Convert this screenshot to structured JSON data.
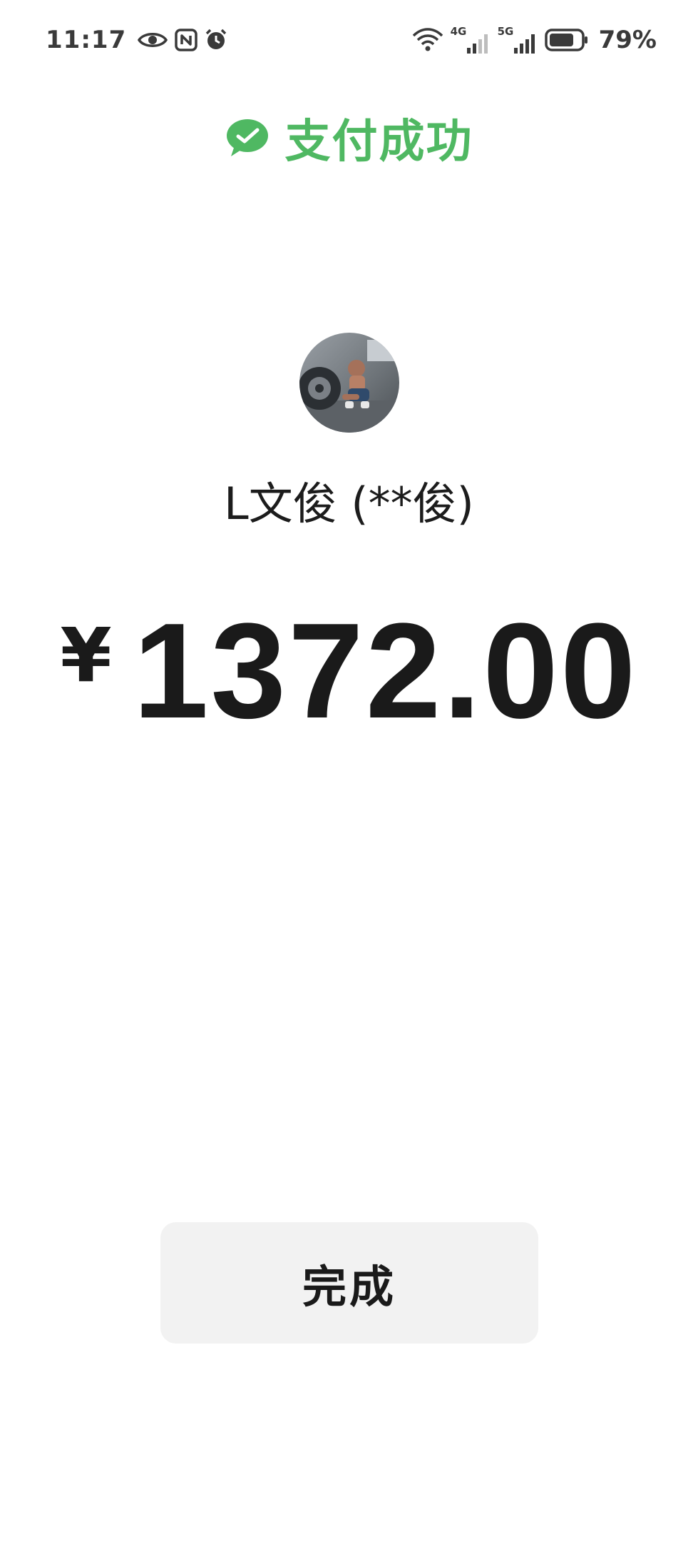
{
  "status_bar": {
    "time": "11:17",
    "left_icons": [
      "eye-icon",
      "nfc-icon",
      "alarm-icon"
    ],
    "network_1": "4G",
    "network_2": "5G",
    "battery_percent": "79%",
    "battery_level": 0.79
  },
  "header": {
    "title": "支付成功",
    "icon": "wechat-pay-check-icon",
    "accent_color": "#4fb862"
  },
  "payee": {
    "name": "L文俊 (**俊)",
    "avatar": "avatar-photo"
  },
  "amount": {
    "currency": "¥",
    "value": "1372.00"
  },
  "actions": {
    "done_label": "完成"
  }
}
